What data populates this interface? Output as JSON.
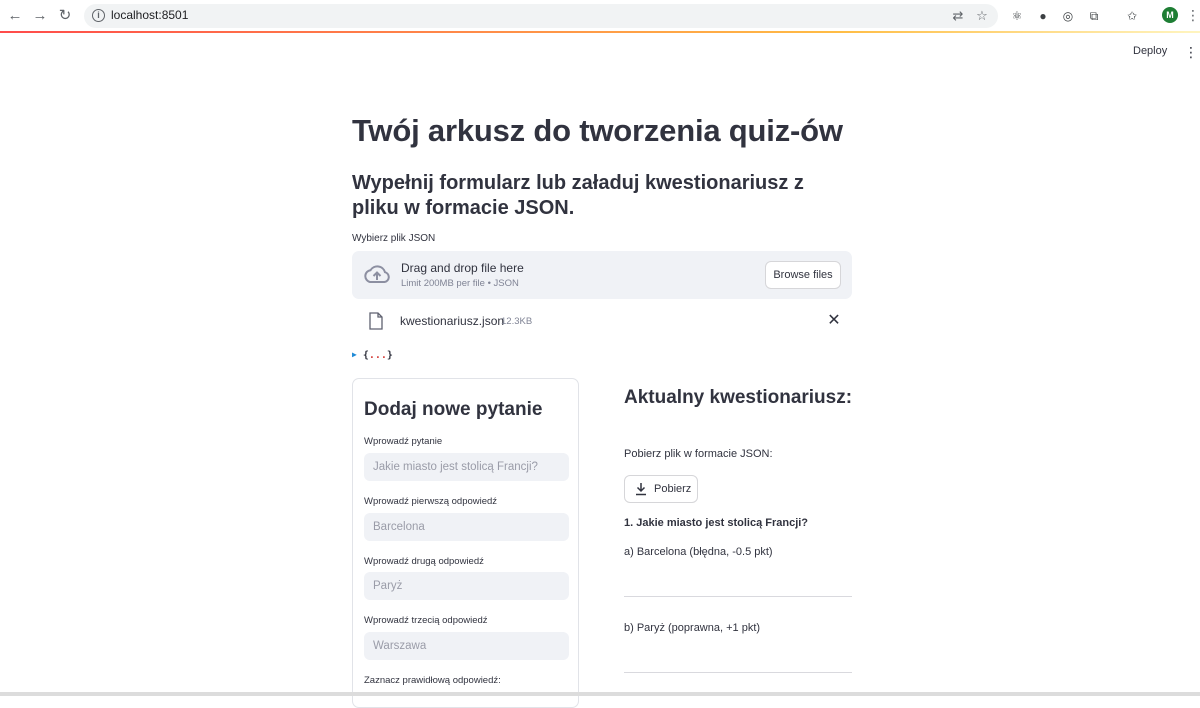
{
  "browser": {
    "url": "localhost:8501"
  },
  "header": {
    "deploy_label": "Deploy"
  },
  "page": {
    "title": "Twój arkusz do tworzenia quiz-ów",
    "subtitle": "Wypełnij formularz lub załaduj kwestionariusz z pliku w formacie JSON."
  },
  "uploader": {
    "label": "Wybierz plik JSON",
    "drop_text": "Drag and drop file here",
    "limit_text": "Limit 200MB per file • JSON",
    "browse_label": "Browse files",
    "file": {
      "name": "kwestionariusz.json",
      "size": "12.3KB"
    }
  },
  "json_viewer": {
    "open_brace": "{",
    "dots": "...",
    "close_brace": "}"
  },
  "form": {
    "title": "Dodaj nowe pytanie",
    "fields": [
      {
        "label": "Wprowadź pytanie",
        "placeholder": "Jakie miasto jest stolicą Francji?"
      },
      {
        "label": "Wprowadź pierwszą odpowiedź",
        "placeholder": "Barcelona"
      },
      {
        "label": "Wprowadź drugą odpowiedź",
        "placeholder": "Paryż"
      },
      {
        "label": "Wprowadź trzecią odpowiedź",
        "placeholder": "Warszawa"
      }
    ],
    "correct_label": "Zaznacz prawidłową odpowiedź:"
  },
  "questionnaire": {
    "title": "Aktualny kwestionariusz:",
    "download_label": "Pobierz plik w formacie JSON:",
    "download_button": "Pobierz",
    "questions": [
      {
        "text": "1. Jakie miasto jest stolicą Francji?",
        "answers": [
          "a) Barcelona (błędna, -0.5 pkt)",
          "b) Paryż (poprawna, +1 pkt)"
        ]
      }
    ]
  },
  "colors": {
    "accent": "#ff4b4b",
    "text": "#31333f",
    "input_bg": "#f0f2f6"
  }
}
